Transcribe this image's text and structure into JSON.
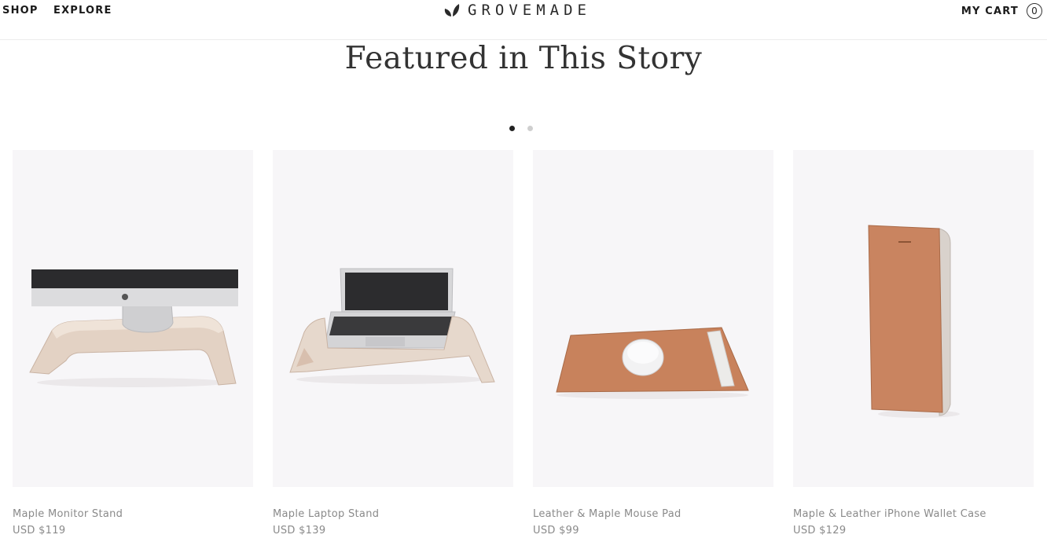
{
  "header": {
    "nav": [
      {
        "label": "SHOP"
      },
      {
        "label": "EXPLORE"
      }
    ],
    "brand": {
      "name": "GROVEMADE",
      "icon": "leaf-logo-icon"
    },
    "cart": {
      "label": "MY CART",
      "count": "0"
    }
  },
  "section": {
    "title": "Featured in This Story"
  },
  "carousel": {
    "dots": [
      {
        "active": true
      },
      {
        "active": false
      }
    ]
  },
  "products": [
    {
      "name": "Maple Monitor Stand",
      "price": "USD $119",
      "image": "monitor-stand-image"
    },
    {
      "name": "Maple Laptop Stand",
      "price": "USD $139",
      "image": "laptop-stand-image"
    },
    {
      "name": "Leather & Maple Mouse Pad",
      "price": "USD $99",
      "image": "mouse-pad-image"
    },
    {
      "name": "Maple & Leather iPhone Wallet Case",
      "price": "USD $129",
      "image": "iphone-wallet-case-image"
    }
  ],
  "colors": {
    "text": "#1a1a1a",
    "muted": "#8a8a8a",
    "card_bg": "#f7f6f8",
    "leather": "#c8825c",
    "maple": "#e2cfc0"
  }
}
